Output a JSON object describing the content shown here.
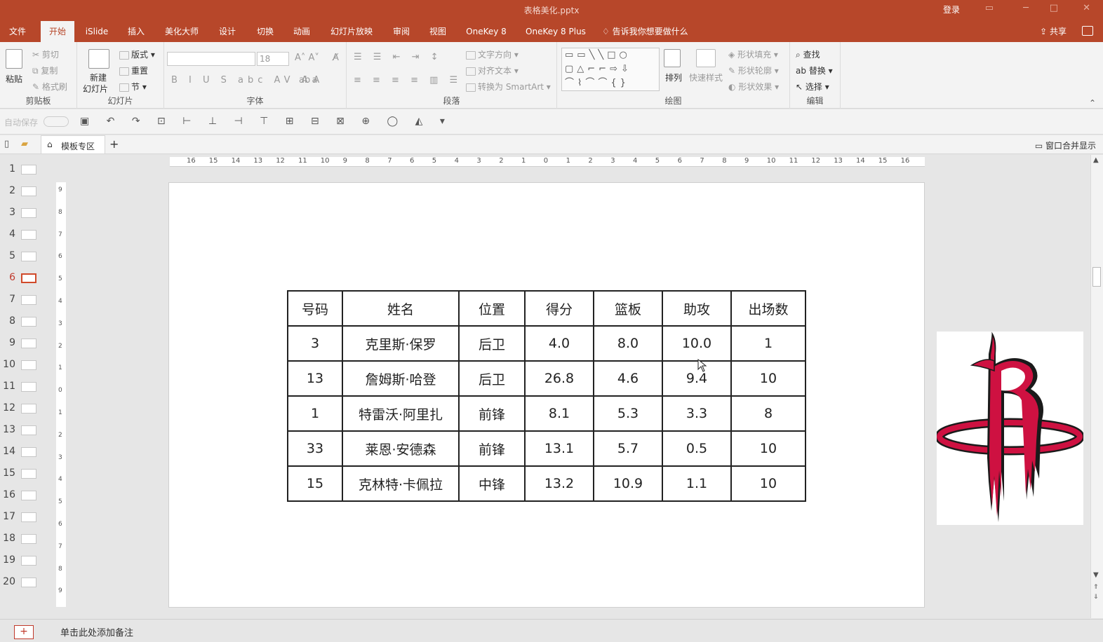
{
  "window": {
    "title": "表格美化.pptx",
    "login": "登录"
  },
  "tabs": [
    "文件",
    "开始",
    "iSlide",
    "插入",
    "美化大师",
    "设计",
    "切换",
    "动画",
    "幻灯片放映",
    "审阅",
    "视图",
    "OneKey 8",
    "OneKey 8 Plus",
    "告诉我你想要做什么"
  ],
  "active_tab": "开始",
  "share_label": "共享",
  "ribbon": {
    "clipboard": {
      "label": "剪贴板",
      "paste": "粘贴",
      "cut": "剪切",
      "copy": "复制",
      "format_painter": "格式刷"
    },
    "slides": {
      "label": "幻灯片",
      "new_slide_line1": "新建",
      "new_slide_line2": "幻灯片",
      "layout": "版式",
      "reset": "重置",
      "section": "节"
    },
    "font": {
      "label": "字体",
      "font_name": "",
      "font_size": "18"
    },
    "paragraph": {
      "label": "段落",
      "text_direction": "文字方向",
      "align_text": "对齐文本",
      "convert_smartart": "转换为 SmartArt"
    },
    "drawing": {
      "label": "绘图",
      "arrange": "排列",
      "quick_styles": "快速样式",
      "shape_fill": "形状填充",
      "shape_outline": "形状轮廓",
      "shape_effects": "形状效果"
    },
    "editing": {
      "label": "编辑",
      "find": "查找",
      "replace": "替换",
      "select": "选择"
    }
  },
  "qat": {
    "autosave": "自动保存"
  },
  "filebar": {
    "template_zone": "模板专区",
    "merge_windows": "窗口合并显示"
  },
  "thumbnails": {
    "numbers": [
      "1",
      "2",
      "3",
      "4",
      "5",
      "6",
      "7",
      "8",
      "9",
      "10",
      "11",
      "12",
      "13",
      "14",
      "15",
      "16",
      "17",
      "18",
      "19",
      "20"
    ],
    "selected": "6"
  },
  "table": {
    "headers": [
      "号码",
      "姓名",
      "位置",
      "得分",
      "篮板",
      "助攻",
      "出场数"
    ],
    "rows": [
      [
        "3",
        "克里斯·保罗",
        "后卫",
        "4.0",
        "8.0",
        "10.0",
        "1"
      ],
      [
        "13",
        "詹姆斯·哈登",
        "后卫",
        "26.8",
        "4.6",
        "9.4",
        "10"
      ],
      [
        "1",
        "特雷沃·阿里扎",
        "前锋",
        "8.1",
        "5.3",
        "3.3",
        "8"
      ],
      [
        "33",
        "莱恩·安德森",
        "前锋",
        "13.1",
        "5.7",
        "0.5",
        "10"
      ],
      [
        "15",
        "克林特·卡佩拉",
        "中锋",
        "13.2",
        "10.9",
        "1.1",
        "10"
      ]
    ]
  },
  "notes_placeholder": "单击此处添加备注",
  "colors": {
    "accent": "#b7472a",
    "logo_red": "#ce1141",
    "logo_dark": "#1a1a1a"
  }
}
